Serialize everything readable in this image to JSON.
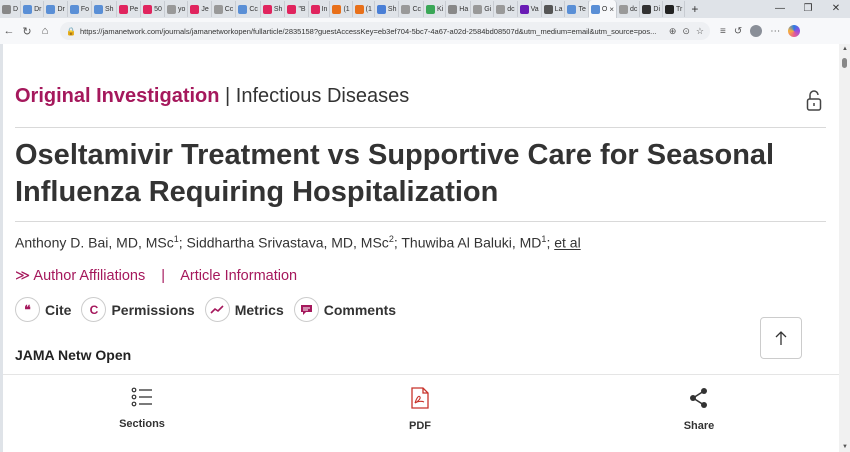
{
  "browser": {
    "tabs": [
      {
        "label": "D",
        "color": "#888"
      },
      {
        "label": "Dr",
        "color": "#5a8fd6"
      },
      {
        "label": "Dr",
        "color": "#5a8fd6"
      },
      {
        "label": "Fo",
        "color": "#5a8fd6"
      },
      {
        "label": "Sh",
        "color": "#5a8fd6"
      },
      {
        "label": "Pe",
        "color": "#e0245e"
      },
      {
        "label": "50",
        "color": "#e0245e"
      },
      {
        "label": "yo",
        "color": "#999"
      },
      {
        "label": "Je",
        "color": "#e0245e"
      },
      {
        "label": "Cc",
        "color": "#999"
      },
      {
        "label": "Cc",
        "color": "#5a8fd6"
      },
      {
        "label": "Sh",
        "color": "#e0245e"
      },
      {
        "label": "\"B",
        "color": "#e0245e"
      },
      {
        "label": "In",
        "color": "#e0245e"
      },
      {
        "label": "(1",
        "color": "#e8701a"
      },
      {
        "label": "(1",
        "color": "#e8701a"
      },
      {
        "label": "Sh",
        "color": "#4a7fd6"
      },
      {
        "label": "Cc",
        "color": "#999"
      },
      {
        "label": "Ki",
        "color": "#3aa757"
      },
      {
        "label": "Ha",
        "color": "#888"
      },
      {
        "label": "Gi",
        "color": "#999"
      },
      {
        "label": "dc",
        "color": "#999"
      },
      {
        "label": "Va",
        "color": "#6a1bb5"
      },
      {
        "label": "La",
        "color": "#555"
      },
      {
        "label": "Te",
        "color": "#5a8fd6"
      }
    ],
    "active_tab": {
      "label": "O",
      "close": "×"
    },
    "tabs_after": [
      {
        "label": "dc",
        "color": "#999"
      },
      {
        "label": "Di",
        "color": "#333"
      },
      {
        "label": "Tr",
        "color": "#222"
      }
    ],
    "new_tab": "+",
    "url": "https://jamanetwork.com/journals/jamanetworkopen/fullarticle/2835158?guestAccessKey=eb3ef704-5bc7-4a67-a02d-2584bd08507d&utm_medium=email&utm_source=pos...",
    "window_controls": {
      "minimize": "—",
      "maximize": "❐",
      "close": "✕"
    }
  },
  "article": {
    "section": "Original Investigation",
    "separator": " | ",
    "category": "Infectious Diseases",
    "title": "Oseltamivir Treatment vs Supportive Care for Seasonal Influenza Requiring Hospitalization",
    "authors": [
      {
        "name": "Anthony D. Bai, MD, MSc",
        "sup": "1",
        "after": "; "
      },
      {
        "name": "Siddhartha Srivastava, MD, MSc",
        "sup": "2",
        "after": "; "
      },
      {
        "name": "Thuwiba Al Baluki, MD",
        "sup": "1",
        "after": "; "
      }
    ],
    "et_al": "et al",
    "affiliations_link": "Author Affiliations",
    "affil_separator": "|",
    "info_link": "Article Information",
    "actions": [
      {
        "icon": "quote-icon",
        "glyph": "❝",
        "label": "Cite"
      },
      {
        "icon": "copyright-icon",
        "glyph": "C",
        "label": "Permissions"
      },
      {
        "icon": "trend-icon",
        "glyph": "↗",
        "label": "Metrics"
      },
      {
        "icon": "comment-icon",
        "glyph": "▬",
        "label": "Comments"
      }
    ],
    "journal": "JAMA Netw Open"
  },
  "bottom_nav": {
    "sections": "Sections",
    "pdf": "PDF",
    "share": "Share"
  }
}
